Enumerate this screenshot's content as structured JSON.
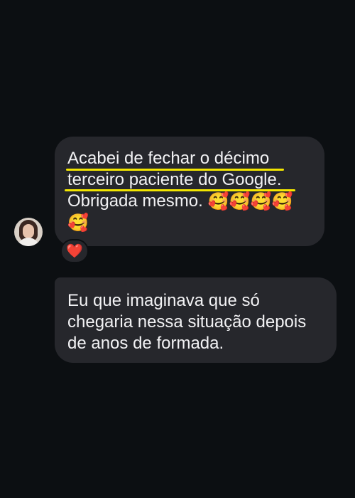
{
  "messages": [
    {
      "lines": [
        "Acabei de fechar o décimo",
        "terceiro paciente do Google.",
        "Obrigada mesmo."
      ],
      "emojis": [
        "🥰",
        "🥰",
        "🥰",
        "🥰",
        "🥰"
      ],
      "reaction": "❤️"
    },
    {
      "lines": [
        "Eu que imaginava que só",
        "chegaria nessa situação depois",
        "de anos de formada."
      ]
    }
  ],
  "colors": {
    "background": "#0c0f12",
    "bubble": "#26272c",
    "text": "#f2f2f4",
    "highlight_underline": "#f3e600",
    "reaction_heart": "#ff3040"
  },
  "icons": {
    "avatar": "user-avatar",
    "reaction": "heart-icon"
  }
}
